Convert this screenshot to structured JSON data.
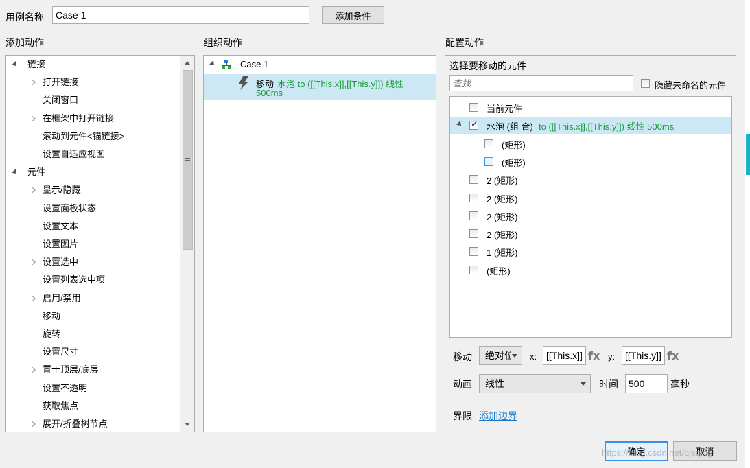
{
  "header": {
    "case_name_label": "用例名称",
    "case_name_value": "Case 1",
    "add_condition_button": "添加条件"
  },
  "add_actions": {
    "title": "添加动作",
    "items": [
      {
        "label": "链接",
        "level": 0,
        "state": "expanded"
      },
      {
        "label": "打开链接",
        "level": 1,
        "state": "collapsed"
      },
      {
        "label": "关闭窗口",
        "level": 1,
        "state": "leaf"
      },
      {
        "label": "在框架中打开链接",
        "level": 1,
        "state": "collapsed"
      },
      {
        "label": "滚动到元件<锚链接>",
        "level": 1,
        "state": "leaf"
      },
      {
        "label": "设置自适应视图",
        "level": 1,
        "state": "leaf"
      },
      {
        "label": "元件",
        "level": 0,
        "state": "expanded"
      },
      {
        "label": "显示/隐藏",
        "level": 1,
        "state": "collapsed"
      },
      {
        "label": "设置面板状态",
        "level": 1,
        "state": "leaf"
      },
      {
        "label": "设置文本",
        "level": 1,
        "state": "leaf"
      },
      {
        "label": "设置图片",
        "level": 1,
        "state": "leaf"
      },
      {
        "label": "设置选中",
        "level": 1,
        "state": "collapsed"
      },
      {
        "label": "设置列表选中项",
        "level": 1,
        "state": "leaf"
      },
      {
        "label": "启用/禁用",
        "level": 1,
        "state": "collapsed"
      },
      {
        "label": "移动",
        "level": 1,
        "state": "leaf"
      },
      {
        "label": "旋转",
        "level": 1,
        "state": "leaf"
      },
      {
        "label": "设置尺寸",
        "level": 1,
        "state": "leaf"
      },
      {
        "label": "置于顶层/底层",
        "level": 1,
        "state": "collapsed"
      },
      {
        "label": "设置不透明",
        "level": 1,
        "state": "leaf"
      },
      {
        "label": "获取焦点",
        "level": 1,
        "state": "leaf"
      },
      {
        "label": "展开/折叠树节点",
        "level": 1,
        "state": "collapsed"
      }
    ]
  },
  "organize_actions": {
    "title": "组织动作",
    "case_label": "Case 1",
    "action_verb": "移动",
    "action_detail_line1": "水泡 to ([[This.x]],[[This.y]]) 线性",
    "action_detail_line2": "500ms"
  },
  "configure": {
    "title": "配置动作",
    "select_label": "选择要移动的元件",
    "search_placeholder": "查找",
    "hide_unnamed_label": "隐藏未命名的元件",
    "widgets": [
      {
        "label": "当前元件",
        "checked": false
      },
      {
        "label": "水泡 (组 合)",
        "detail": "to ([[This.x]],[[This.y]]) 线性 500ms",
        "checked": true
      },
      {
        "label": "(矩形)",
        "checked": false
      },
      {
        "label": "(矩形)",
        "checked": false
      },
      {
        "label": "2 (矩形)",
        "checked": false
      },
      {
        "label": "2 (矩形)",
        "checked": false
      },
      {
        "label": "2 (矩形)",
        "checked": false
      },
      {
        "label": "2 (矩形)",
        "checked": false
      },
      {
        "label": "1 (矩形)",
        "checked": false
      },
      {
        "label": "(矩形)",
        "checked": false
      }
    ],
    "move_label": "移动",
    "move_mode": "绝对位",
    "x_label": "x:",
    "x_value": "[[This.x]]",
    "y_label": "y:",
    "y_value": "[[This.y]]",
    "fx_label": "fx",
    "anim_label": "动画",
    "anim_value": "线性",
    "time_label": "时间",
    "time_value": "500",
    "ms_label": "毫秒",
    "bound_label": "界限",
    "add_bound_link": "添加边界"
  },
  "footer": {
    "ok_button": "确定",
    "cancel_button": "取消",
    "watermark": "https://blog.csdn.net/qlsqing"
  },
  "colors": {
    "selection": "#cce8f5",
    "green_text": "#1a9a3a",
    "link": "#1b79c9",
    "ok_border": "#3c8fd8"
  }
}
